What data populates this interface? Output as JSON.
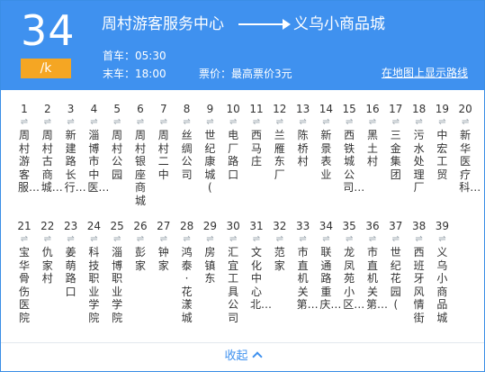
{
  "route": {
    "number": "34",
    "badge": "/k",
    "from": "周村游客服务中心",
    "to": "义乌小商品城",
    "first_bus": "首车：05:30",
    "last_bus": "末车：18:00",
    "fare": "票价：最高票价3元",
    "map_link": "在地图上显示路线"
  },
  "stop_arrow_glyph": "⇌",
  "stops": [
    {
      "num": "1",
      "name": "周村游客服…"
    },
    {
      "num": "2",
      "name": "周村古商城…"
    },
    {
      "num": "3",
      "name": "新建路长行…"
    },
    {
      "num": "4",
      "name": "淄博市中医…"
    },
    {
      "num": "5",
      "name": "周村公园"
    },
    {
      "num": "6",
      "name": "周村银座商城"
    },
    {
      "num": "7",
      "name": "周村二中"
    },
    {
      "num": "8",
      "name": "丝绸公司"
    },
    {
      "num": "9",
      "name": "世纪康城("
    },
    {
      "num": "10",
      "name": "电厂路口"
    },
    {
      "num": "11",
      "name": "西马庄"
    },
    {
      "num": "12",
      "name": "兰雁东厂"
    },
    {
      "num": "13",
      "name": "陈桥村"
    },
    {
      "num": "14",
      "name": "新景表业"
    },
    {
      "num": "15",
      "name": "西铁城公司…"
    },
    {
      "num": "16",
      "name": "黑土村"
    },
    {
      "num": "17",
      "name": "三金集团"
    },
    {
      "num": "18",
      "name": "污水处理厂"
    },
    {
      "num": "19",
      "name": "中宏工贸"
    },
    {
      "num": "20",
      "name": "新华医疗科…"
    },
    {
      "num": "21",
      "name": "宝华骨伤医院"
    },
    {
      "num": "22",
      "name": "仇家村"
    },
    {
      "num": "23",
      "name": "姜萌路口"
    },
    {
      "num": "24",
      "name": "科技职业学院"
    },
    {
      "num": "25",
      "name": "淄博职业学院"
    },
    {
      "num": "26",
      "name": "彭家"
    },
    {
      "num": "27",
      "name": "钟家"
    },
    {
      "num": "28",
      "name": "鸿泰·花漾城"
    },
    {
      "num": "29",
      "name": "房镇东"
    },
    {
      "num": "30",
      "name": "汇宜工具公司"
    },
    {
      "num": "31",
      "name": "文化中心北…"
    },
    {
      "num": "32",
      "name": "范家"
    },
    {
      "num": "33",
      "name": "市直机关第…"
    },
    {
      "num": "34",
      "name": "联通路重庆…"
    },
    {
      "num": "35",
      "name": "龙凤苑小区…"
    },
    {
      "num": "36",
      "name": "市直机关第…"
    },
    {
      "num": "37",
      "name": "世纪花园("
    },
    {
      "num": "38",
      "name": "西班牙风情街"
    },
    {
      "num": "39",
      "name": "义乌小商品城"
    }
  ],
  "collapse_label": "收起",
  "colors": {
    "header_bg": "#3f91ef",
    "badge_bg": "#f5a623",
    "link": "#3f91ef"
  }
}
